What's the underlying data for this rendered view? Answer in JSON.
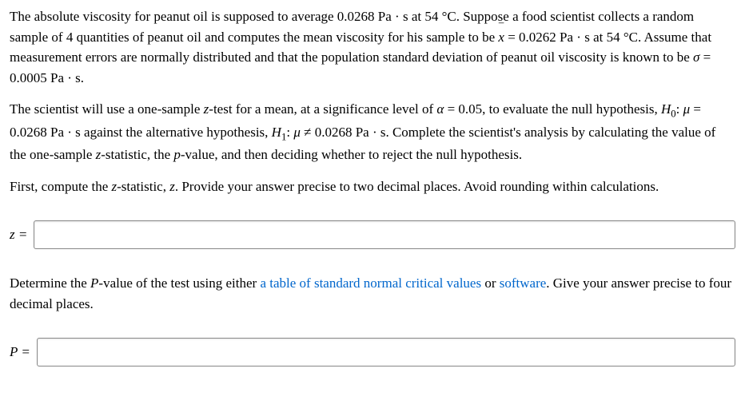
{
  "paragraphs": {
    "p1a": "The absolute viscosity for peanut oil is supposed to average 0.0268 Pa · s at 54 °C. Suppose a food scientist collects a random sample of 4 quantities of peanut oil and computes the mean viscosity for his sample to be ",
    "xbar": "x",
    "p1b": " = 0.0262 Pa · s at 54 °C. Assume that measurement errors are normally distributed and that the population standard deviation of peanut oil viscosity is known to be ",
    "sigma": "σ",
    "p1c": " = 0.0005 Pa · s.",
    "p2a": "The scientist will use a one-sample ",
    "z1": "z",
    "p2b": "-test for a mean, at a significance level of ",
    "alpha": "α",
    "p2c": " = 0.05, to evaluate the null hypothesis, ",
    "h0": "H",
    "h0sub": "0",
    "p2d": ": ",
    "mu1": "μ",
    "p2e": " = 0.0268 Pa · s against the alternative hypothesis, ",
    "h1": "H",
    "h1sub": "1",
    "p2f": ": ",
    "mu2": "μ",
    "p2g": " ≠ 0.0268 Pa · s. Complete the scientist's analysis by calculating the value of the one-sample ",
    "z2": "z",
    "p2h": "-statistic, the ",
    "pval1": "p",
    "p2i": "-value, and then deciding whether to reject the null hypothesis.",
    "p3a": "First, compute the ",
    "z3": "z",
    "p3b": "-statistic, ",
    "z4": "z",
    "p3c": ". Provide your answer precise to two decimal places. Avoid rounding within calculations.",
    "p4a": "Determine the ",
    "Pval": "P",
    "p4b": "-value of the test using either ",
    "link1": "a table of standard normal critical values",
    "p4c": " or ",
    "link2": "software",
    "p4d": ". Give your answer precise to four decimal places."
  },
  "labels": {
    "z_equals": "z =",
    "p_equals": "P ="
  }
}
